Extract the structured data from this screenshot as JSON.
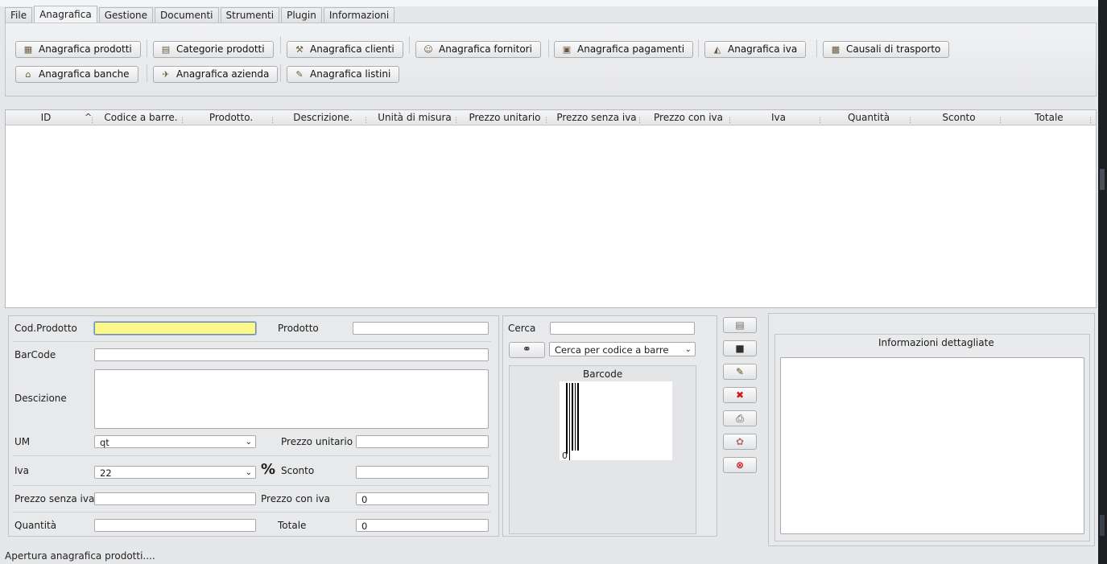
{
  "tabs": [
    "File",
    "Anagrafica",
    "Gestione",
    "Documenti",
    "Strumenti",
    "Plugin",
    "Informazioni"
  ],
  "ribbon": {
    "row1": [
      {
        "label": "Anagrafica prodotti",
        "icon": "product-list-icon",
        "glyph": "▦"
      },
      {
        "label": "Categorie prodotti",
        "icon": "categories-icon",
        "glyph": "▤"
      },
      {
        "label": "Anagrafica clienti",
        "icon": "clients-icon",
        "glyph": "⚒"
      },
      {
        "label": "Anagrafica fornitori",
        "icon": "suppliers-icon",
        "glyph": "☺"
      },
      {
        "label": "Anagrafica pagamenti",
        "icon": "payments-icon",
        "glyph": "▣"
      },
      {
        "label": "Anagrafica iva",
        "icon": "vat-icon",
        "glyph": "◭"
      },
      {
        "label": "Causali di trasporto",
        "icon": "transport-icon",
        "glyph": "▩"
      }
    ],
    "row2": [
      {
        "label": "Anagrafica banche",
        "icon": "bank-icon",
        "glyph": "⌂"
      },
      {
        "label": "Anagrafica azienda",
        "icon": "company-icon",
        "glyph": "✈"
      },
      {
        "label": "Anagrafica listini",
        "icon": "price-lists-icon",
        "glyph": "✎"
      }
    ]
  },
  "table": {
    "columns": [
      "ID",
      "Codice a barre.",
      "Prodotto.",
      "Descrizione.",
      "Unità di misura",
      "Prezzo unitario",
      "Prezzo senza iva",
      "Prezzo con iva",
      "Iva",
      "Quantità",
      "Sconto",
      "Totale"
    ],
    "rows": []
  },
  "form": {
    "cod_prodotto_label": "Cod.Prodotto",
    "cod_prodotto_value": "",
    "prodotto_label": "Prodotto",
    "barcode_label": "BarCode",
    "descrizione_label": "Descizione",
    "um_label": "UM",
    "um_value": "qt",
    "prezzo_unitario_label": "Prezzo unitario",
    "iva_label": "Iva",
    "iva_value": "22",
    "percent_symbol": "%",
    "sconto_label": "Sconto",
    "prezzo_senza_iva_label": "Prezzo senza iva",
    "prezzo_con_iva_label": "Prezzo con iva",
    "prezzo_con_iva_value": "0",
    "quantita_label": "Quantità",
    "totale_label": "Totale",
    "totale_value": "0"
  },
  "search": {
    "label": "Cerca",
    "mode_value": "Cerca per codice a barre",
    "barcode_title": "Barcode",
    "barcode_digit": "0"
  },
  "actions": [
    {
      "icon": "new-icon",
      "glyph": "▤",
      "color": "#6a6a6a"
    },
    {
      "icon": "save-icon",
      "glyph": "■",
      "color": "#303030"
    },
    {
      "icon": "edit-icon",
      "glyph": "✎",
      "color": "#5a4a10"
    },
    {
      "icon": "delete-icon",
      "glyph": "✖",
      "color": "#d01818"
    },
    {
      "icon": "print-icon",
      "glyph": "⎙",
      "color": "#444"
    },
    {
      "icon": "plugin-icon",
      "glyph": "✿",
      "color": "#b07070"
    },
    {
      "icon": "close-icon",
      "glyph": "⊗",
      "color": "#d01818"
    }
  ],
  "info": {
    "title": "Informazioni dettagliate"
  },
  "status": "Apertura anagrafica prodotti...."
}
